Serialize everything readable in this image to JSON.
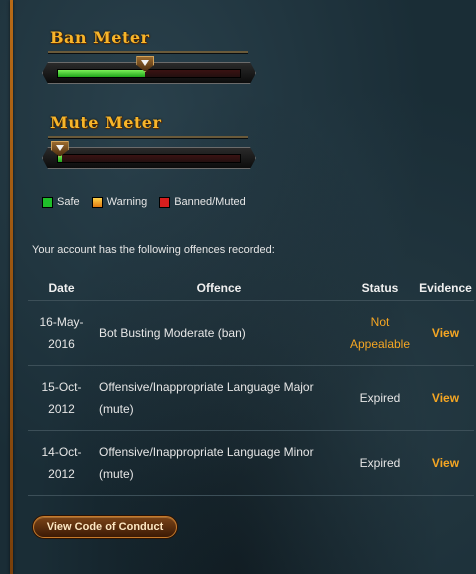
{
  "ban_meter": {
    "title": "Ban Meter",
    "level": 0.48
  },
  "mute_meter": {
    "title": "Mute Meter",
    "level": 0.02
  },
  "legend": [
    {
      "label": "Safe",
      "color": "#1fbf2a"
    },
    {
      "label": "Warning",
      "color": "#f5a623"
    },
    {
      "label": "Banned/Muted",
      "color": "#d81e1e"
    }
  ],
  "intro": "Your account has the following offences recorded:",
  "table": {
    "headers": [
      "Date",
      "Offence",
      "Status",
      "Evidence"
    ],
    "rows": [
      {
        "date_line1": "16-May-",
        "date_line2": "2016",
        "offence_line1": "Bot Busting Moderate (ban)",
        "offence_line2": "",
        "status_line1": "Not",
        "status_line2": "Appealable",
        "status_color": "#f5a623",
        "evidence": "View"
      },
      {
        "date_line1": "15-Oct-",
        "date_line2": "2012",
        "offence_line1": "Offensive/Inappropriate Language Major",
        "offence_line2": "(mute)",
        "status_line1": "Expired",
        "status_line2": "",
        "status_color": "#e6e6e6",
        "evidence": "View"
      },
      {
        "date_line1": "14-Oct-",
        "date_line2": "2012",
        "offence_line1": "Offensive/Inappropriate Language Minor",
        "offence_line2": "(mute)",
        "status_line1": "Expired",
        "status_line2": "",
        "status_color": "#e6e6e6",
        "evidence": "View"
      }
    ]
  },
  "code_of_conduct_button": "View Code of Conduct"
}
